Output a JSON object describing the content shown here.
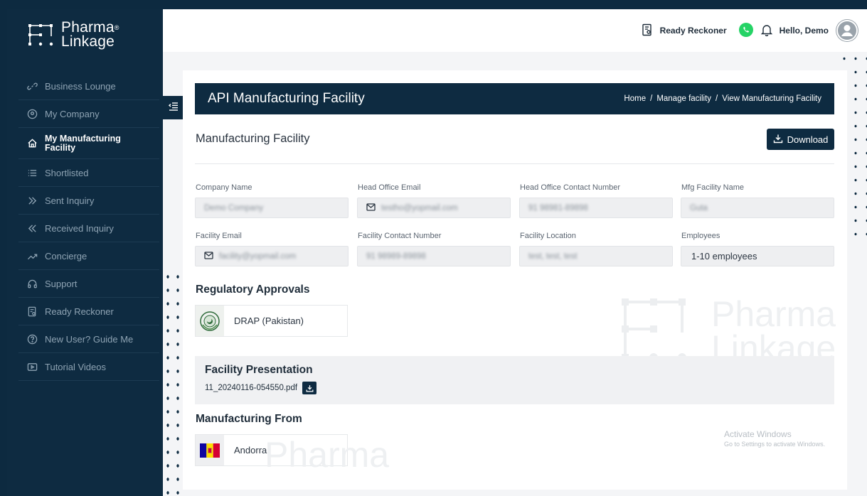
{
  "brand": {
    "line1": "Pharma",
    "line2": "Linkage",
    "reg": "®"
  },
  "sidebar": {
    "items": [
      {
        "label": "Business Lounge",
        "icon": "link-icon"
      },
      {
        "label": "My Company",
        "icon": "location-pin-icon"
      },
      {
        "label": "My Manufacturing Facility",
        "icon": "home-icon",
        "active": true
      },
      {
        "label": "Shortlisted",
        "icon": "list-icon"
      },
      {
        "label": "Sent Inquiry",
        "icon": "double-chevron-right-icon"
      },
      {
        "label": "Received Inquiry",
        "icon": "double-chevron-left-icon"
      },
      {
        "label": "Concierge",
        "icon": "trend-icon"
      },
      {
        "label": "Support",
        "icon": "headset-icon"
      },
      {
        "label": "Ready Reckoner",
        "icon": "document-search-icon"
      },
      {
        "label": "New User? Guide Me",
        "icon": "help-circle-icon"
      },
      {
        "label": "Tutorial Videos",
        "icon": "video-icon"
      }
    ]
  },
  "header": {
    "ready_reckoner": "Ready Reckoner",
    "greeting": "Hello, Demo"
  },
  "banner": {
    "title": "API Manufacturing Facility",
    "breadcrumb": [
      "Home",
      "Manage facility",
      "View Manufacturing Facility"
    ],
    "separator": "/"
  },
  "main": {
    "section_title": "Manufacturing Facility",
    "download_label": "Download",
    "fields": [
      {
        "label": "Company Name",
        "value": "Demo Company"
      },
      {
        "label": "Head Office Email",
        "value": "testho@yopmail.com"
      },
      {
        "label": "Head Office Contact Number",
        "value": "91 98981-89898"
      },
      {
        "label": "Mfg Facility Name",
        "value": "Guta"
      },
      {
        "label": "Facility Email",
        "value": "facility@yopmail.com"
      },
      {
        "label": "Facility Contact Number",
        "value": "91 98989-89898"
      },
      {
        "label": "Facility Location",
        "value": "test, test, test"
      },
      {
        "label": "Employees",
        "value": "1-10 employees"
      }
    ],
    "regulatory_title": "Regulatory Approvals",
    "regulatory_item": "DRAP (Pakistan)",
    "presentation_title": "Facility Presentation",
    "presentation_file": "11_20240116-054550.pdf",
    "mfg_from_title": "Manufacturing From",
    "mfg_from_country": "Andorra"
  },
  "watermark": {
    "line1": "Pharma",
    "line2": "Linkage"
  },
  "os_notice": {
    "title": "Activate Windows",
    "subtitle": "Go to Settings to activate Windows."
  },
  "colors": {
    "navy": "#0e2b41",
    "whatsapp": "#25d366"
  }
}
